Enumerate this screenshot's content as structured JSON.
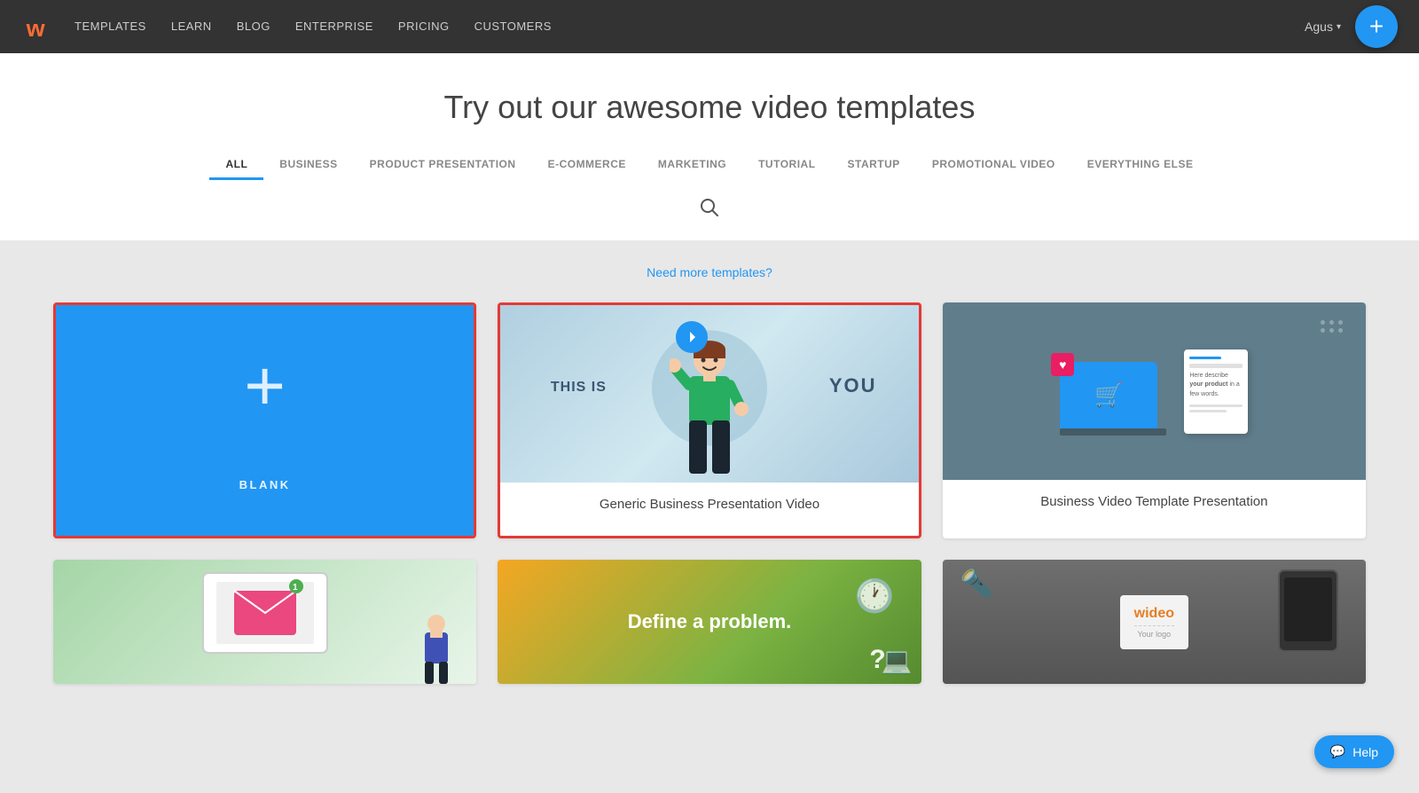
{
  "navbar": {
    "logo_text": "w",
    "links": [
      {
        "label": "TEMPLATES",
        "href": "#"
      },
      {
        "label": "LEARN",
        "href": "#"
      },
      {
        "label": "BLOG",
        "href": "#"
      },
      {
        "label": "ENTERPRISE",
        "href": "#"
      },
      {
        "label": "PRICING",
        "href": "#"
      },
      {
        "label": "CUSTOMERS",
        "href": "#"
      }
    ],
    "user_name": "Agus",
    "add_btn_label": "+",
    "add_btn_aria": "Create new"
  },
  "header": {
    "title": "Try out our awesome video templates",
    "tabs": [
      {
        "label": "ALL",
        "active": true
      },
      {
        "label": "BUSINESS",
        "active": false
      },
      {
        "label": "PRODUCT PRESENTATION",
        "active": false
      },
      {
        "label": "E-COMMERCE",
        "active": false
      },
      {
        "label": "MARKETING",
        "active": false
      },
      {
        "label": "TUTORIAL",
        "active": false
      },
      {
        "label": "STARTUP",
        "active": false
      },
      {
        "label": "PROMOTIONAL VIDEO",
        "active": false
      },
      {
        "label": "EVERYTHING ELSE",
        "active": false
      }
    ],
    "search_placeholder": "Search templates"
  },
  "main": {
    "need_more_label": "Need more templates?",
    "cards": [
      {
        "id": "blank",
        "label": "BLANK",
        "selected": true,
        "type": "blank"
      },
      {
        "id": "generic-business",
        "label": "Generic Business Presentation Video",
        "selected": true,
        "type": "generic-business"
      },
      {
        "id": "business-video",
        "label": "Business Video Template Presentation",
        "selected": false,
        "type": "business-video"
      },
      {
        "id": "email-marketing",
        "label": "",
        "selected": false,
        "type": "email-marketing"
      },
      {
        "id": "define-problem",
        "label": "",
        "selected": false,
        "type": "define-problem",
        "overlay_text": "Define a problem."
      },
      {
        "id": "wideo-template",
        "label": "",
        "selected": false,
        "type": "wideo-template"
      }
    ]
  },
  "help_btn": {
    "label": "Help",
    "icon": "💬"
  },
  "colors": {
    "accent_blue": "#2196F3",
    "selected_border": "#e53935",
    "nav_bg": "#333333"
  }
}
